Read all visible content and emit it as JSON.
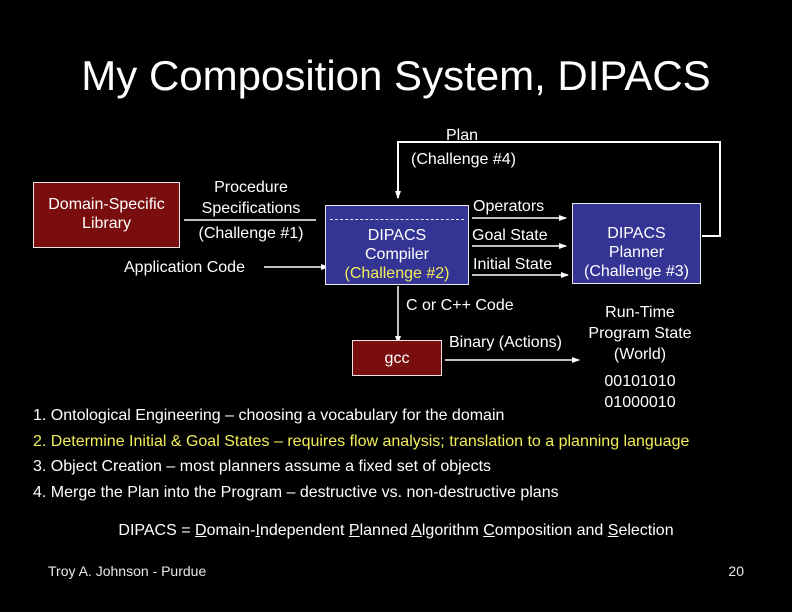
{
  "slide": {
    "title": "My Composition System, DIPACS",
    "diagram": {
      "plan_label": "Plan",
      "plan_challenge": "(Challenge #4)",
      "domain_library": {
        "line1": "Domain-Specific",
        "line2": "Library"
      },
      "procedure_specs": {
        "line1": "Procedure",
        "line2": "Specifications",
        "challenge": "(Challenge #1)"
      },
      "application_code": "Application Code",
      "compiler": {
        "line1": "DIPACS",
        "line2": "Compiler",
        "challenge": "(Challenge #2)"
      },
      "planner": {
        "line1": "DIPACS",
        "line2": "Planner",
        "challenge": "(Challenge #3)"
      },
      "arrows": {
        "operators": "Operators",
        "goal_state": "Goal State",
        "initial_state": "Initial State"
      },
      "c_code": "C or C++ Code",
      "gcc": "gcc",
      "binary": "Binary (Actions)",
      "runtime": {
        "line1": "Run-Time",
        "line2": "Program State",
        "line3": "(World)",
        "bits1": "00101010",
        "bits2": "01000010"
      }
    },
    "list": [
      {
        "text": "1. Ontological Engineering – choosing a vocabulary for the domain",
        "highlight": false
      },
      {
        "text": "2. Determine Initial & Goal States – requires flow analysis; translation to a planning language",
        "highlight": true
      },
      {
        "text": "3. Object Creation – most planners assume a fixed set of objects",
        "highlight": false
      },
      {
        "text": "4. Merge the Plan into the Program – destructive vs. non-destructive plans",
        "highlight": false
      }
    ],
    "acronym": {
      "prefix": "DIPACS = ",
      "parts": [
        {
          "u": "D",
          "rest": "omain-"
        },
        {
          "u": "I",
          "rest": "ndependent "
        },
        {
          "u": "P",
          "rest": "lanned "
        },
        {
          "u": "A",
          "rest": "lgorithm "
        },
        {
          "u": "C",
          "rest": "omposition and "
        },
        {
          "u": "S",
          "rest": "election"
        }
      ]
    },
    "footer": {
      "author": "Troy A. Johnson - Purdue",
      "page": "20"
    },
    "colors": {
      "background": "#000000",
      "red_box": "#7a0d0d",
      "blue_box": "#343494",
      "highlight": "#f2ee58"
    }
  }
}
